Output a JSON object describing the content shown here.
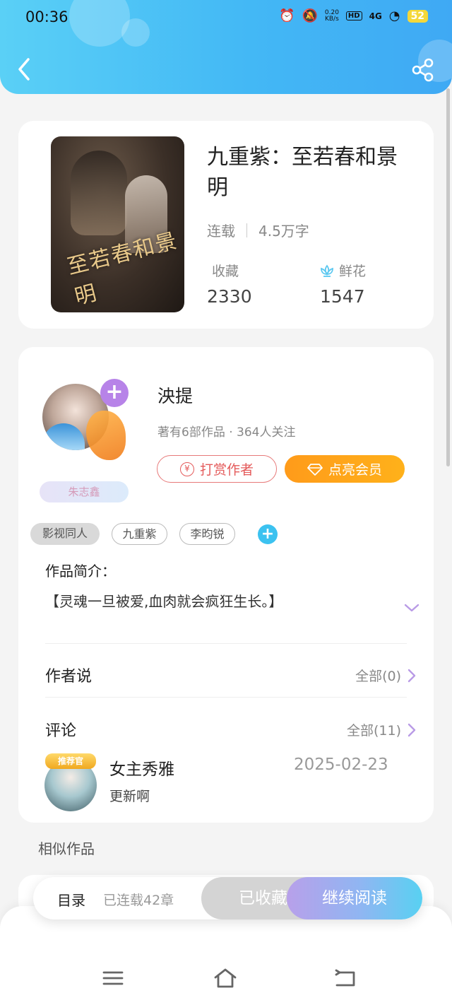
{
  "status_bar": {
    "time": "00:36",
    "net_speed_value": "0.20",
    "net_speed_unit": "KB/s",
    "hd": "HD",
    "network": "4G",
    "battery": "52"
  },
  "book": {
    "title": "九重紫：至若春和景明",
    "status": "连载",
    "word_count": "4.5万字",
    "favorites_label": "收藏",
    "favorites_value": "2330",
    "flowers_label": "鲜花",
    "flowers_value": "1547",
    "cover_text": "至若春和景明"
  },
  "author": {
    "name": "泱提",
    "stats": "著有6部作品 · 364人关注",
    "name_plate": "朱志鑫",
    "tip_label": "打赏作者",
    "vip_label": "点亮会员"
  },
  "tags": [
    "影视同人",
    "九重紫",
    "李昀锐"
  ],
  "intro": {
    "label": "作品简介：",
    "text": "【灵魂一旦被爱,血肉就会疯狂生长。】"
  },
  "author_says": {
    "label": "作者说",
    "more": "全部(0)"
  },
  "comments": {
    "label": "评论",
    "more": "全部(11)",
    "items": [
      {
        "badge": "推荐官",
        "user": "女主秀雅",
        "date": "2025-02-23",
        "text": "更新啊"
      }
    ]
  },
  "similar_label": "相似作品",
  "action_bar": {
    "toc": "目录",
    "chapters": "已连载42章",
    "collected": "已收藏",
    "continue": "继续阅读"
  },
  "colors": {
    "header_start": "#5ad0f6",
    "header_end": "#3fa9f4",
    "accent_purple": "#b783e8",
    "tip_red": "#e45a5a",
    "vip_orange": "#ff9b1a",
    "tag_blue": "#3cc2f0"
  },
  "icons": {
    "back": "chevron-left-icon",
    "share": "share-icon",
    "flower": "lotus-icon",
    "expand": "chevron-down-icon",
    "more": "chevron-right-icon"
  }
}
